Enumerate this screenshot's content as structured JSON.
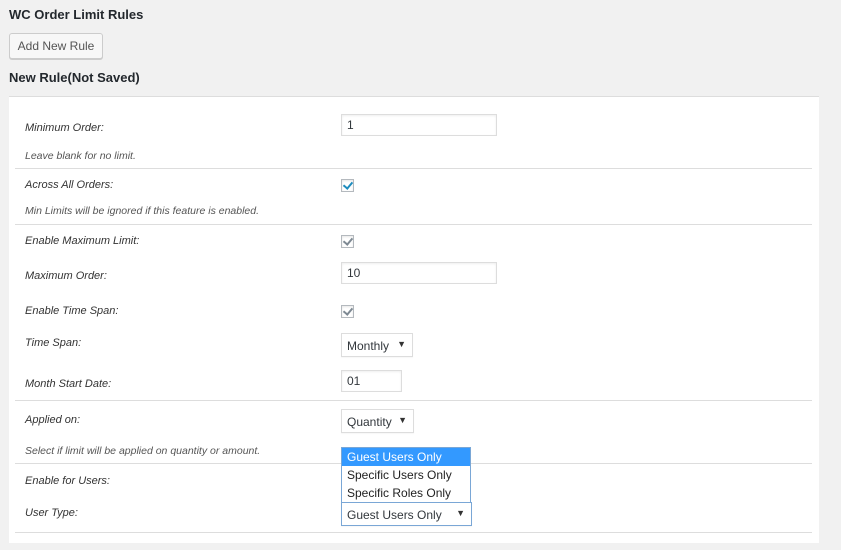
{
  "page": {
    "title": "WC Order Limit Rules",
    "add_button": "Add New Rule",
    "section_title": "New Rule(Not Saved)"
  },
  "fields": {
    "minimum_order": {
      "label": "Minimum Order:",
      "value": "1",
      "hint": "Leave blank for no limit."
    },
    "across_all_orders": {
      "label": "Across All Orders:",
      "checked": true,
      "hint": "Min Limits will be ignored if this feature is enabled."
    },
    "enable_maximum_limit": {
      "label": "Enable Maximum Limit:",
      "checked": true
    },
    "maximum_order": {
      "label": "Maximum Order:",
      "value": "10"
    },
    "enable_time_span": {
      "label": "Enable Time Span:",
      "checked": true
    },
    "time_span": {
      "label": "Time Span:",
      "selected": "Monthly"
    },
    "month_start_date": {
      "label": "Month Start Date:",
      "value": "01"
    },
    "applied_on": {
      "label": "Applied on:",
      "selected": "Quantity",
      "hint": "Select if limit will be applied on quantity or amount."
    },
    "enable_for_users": {
      "label": "Enable for Users:"
    },
    "user_type": {
      "label": "User Type:",
      "selected": "Guest Users Only",
      "options": [
        "Guest Users Only",
        "Specific Users Only",
        "Specific Roles Only"
      ]
    }
  },
  "colors": {
    "accent_check": "#1e8cbe",
    "dropdown_highlight": "#3399ff",
    "panel_bg": "#ffffff",
    "page_bg": "#f1f1f1"
  }
}
